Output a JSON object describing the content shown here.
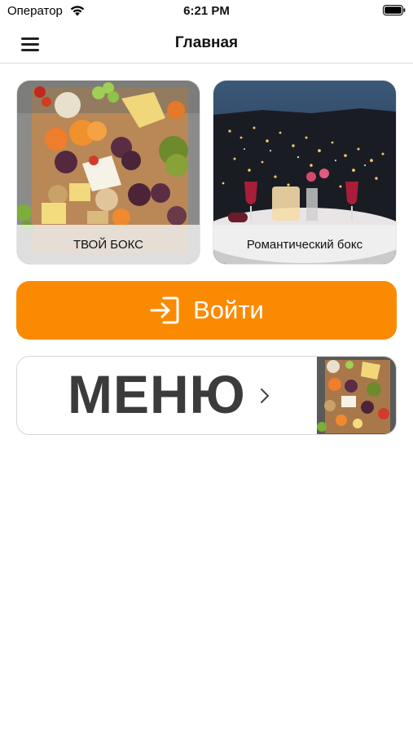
{
  "status_bar": {
    "carrier": "Оператор",
    "time": "6:21 PM"
  },
  "navbar": {
    "title": "Главная",
    "menu_icon": "hamburger-menu-icon"
  },
  "cards": [
    {
      "label": "ТВОЙ БОКС",
      "image": "charcuterie-board-photo"
    },
    {
      "label": "Романтический бокс",
      "image": "romantic-dinner-city-night-photo"
    }
  ],
  "login": {
    "label": "Войти",
    "icon": "login-arrow-icon",
    "color": "#fb8a03"
  },
  "menu": {
    "label": "МЕНЮ",
    "icon": "chevron-right-icon",
    "image": "charcuterie-board-photo"
  }
}
